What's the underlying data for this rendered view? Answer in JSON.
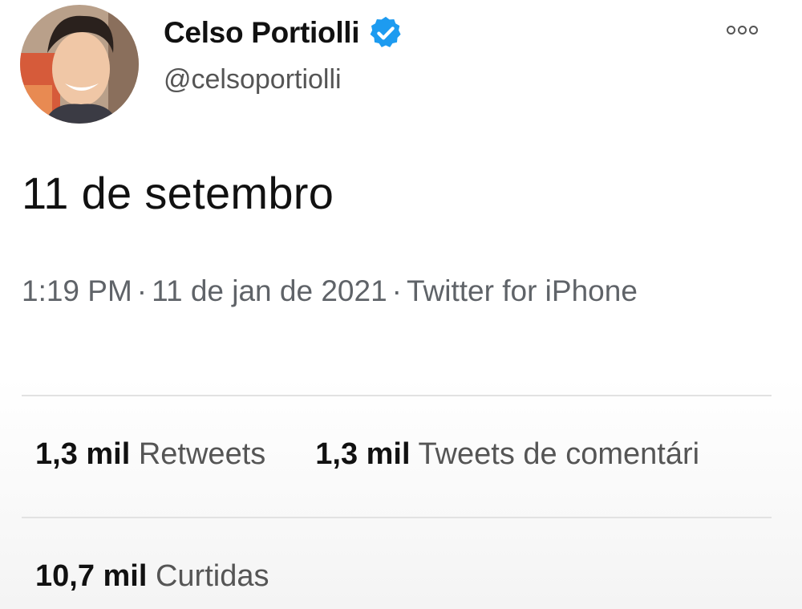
{
  "user": {
    "display_name": "Celso Portiolli",
    "handle": "@celsoportiolli",
    "verified_icon": "verified-badge-icon",
    "badge_color": "#1d9bf0"
  },
  "tweet": {
    "text": "11 de setembro",
    "time": "1:19 PM",
    "date": "11 de jan de 2021",
    "source": "Twitter for iPhone"
  },
  "stats": {
    "retweets_count": "1,3 mil",
    "retweets_label": "Retweets",
    "quote_count": "1,3 mil",
    "quote_label": "Tweets de comentári",
    "likes_count": "10,7 mil",
    "likes_label": "Curtidas"
  },
  "icons": {
    "more": "more-options-icon"
  }
}
